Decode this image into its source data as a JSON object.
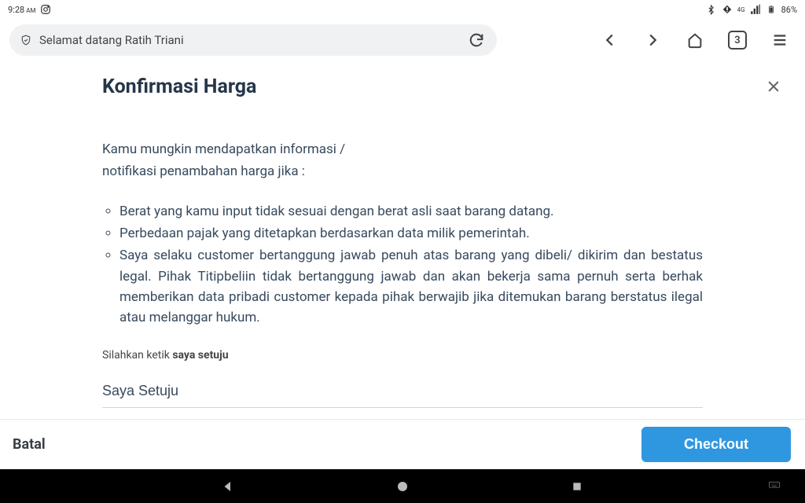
{
  "status": {
    "time": "9:28",
    "ampm": "AM",
    "battery_pct": "86%",
    "net_label": "4G"
  },
  "chrome": {
    "url_text": "Selamat datang Ratih Triani",
    "tab_count": "3"
  },
  "modal": {
    "title": "Konfirmasi Harga",
    "intro_line1": "Kamu mungkin mendapatkan informasi /",
    "intro_line2": "notifikasi penambahan harga jika :",
    "bullets": [
      "Berat yang kamu input tidak sesuai dengan berat asli saat barang datang.",
      "Perbedaan pajak yang ditetapkan berdasarkan data milik pemerintah.",
      "Saya selaku customer bertanggung jawab penuh atas barang yang dibeli/ dikirim dan bestatus legal. Pihak Titipbeliin tidak bertanggung jawab dan akan bekerja sama pernuh serta berhak memberikan data pribadi customer kepada pihak berwajib jika ditemukan barang berstatus ilegal atau melanggar hukum."
    ],
    "prompt_prefix": "Silahkan ketik ",
    "prompt_bold": "saya setuju",
    "input_value": "Saya Setuju"
  },
  "footer": {
    "cancel": "Batal",
    "checkout": "Checkout"
  }
}
